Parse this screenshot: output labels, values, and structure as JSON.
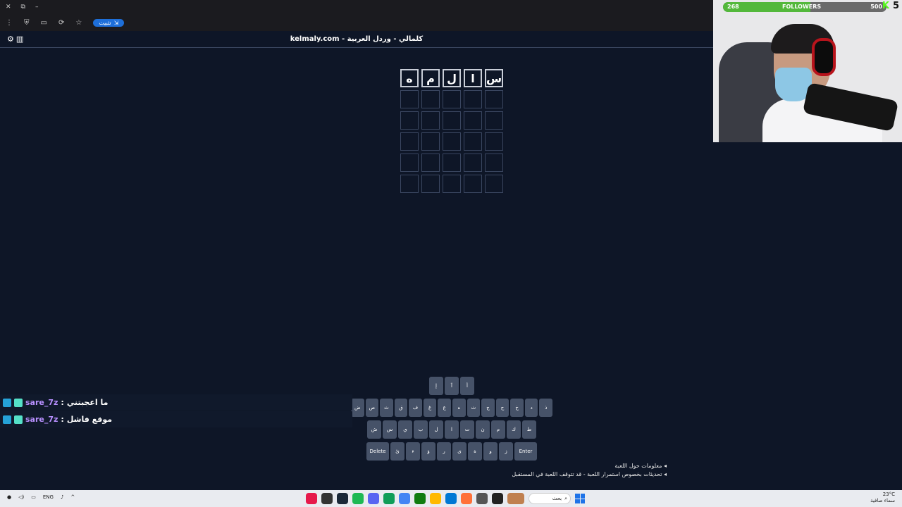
{
  "browser": {
    "pill_label": "تثبيت"
  },
  "site": {
    "title": "kelmaly.com - كلمالي - وردل العربية"
  },
  "board": {
    "rows": [
      [
        "س",
        "ا",
        "ل",
        "م",
        "ه"
      ],
      [
        "",
        "",
        "",
        "",
        ""
      ],
      [
        "",
        "",
        "",
        "",
        ""
      ],
      [
        "",
        "",
        "",
        "",
        ""
      ],
      [
        "",
        "",
        "",
        "",
        ""
      ],
      [
        "",
        "",
        "",
        "",
        ""
      ]
    ]
  },
  "keyboard": {
    "row1": [
      "أ",
      "آ",
      "إ"
    ],
    "row2": [
      "ذ",
      "د",
      "خ",
      "ح",
      "ج",
      "ث",
      "ه",
      "ع",
      "غ",
      "ف",
      "ق",
      "ث",
      "ص",
      "ض"
    ],
    "row3": [
      "ط",
      "ك",
      "م",
      "ن",
      "ت",
      "ا",
      "ل",
      "ب",
      "ي",
      "س",
      "ش"
    ],
    "row4": [
      "Enter",
      "ز",
      "و",
      "ة",
      "ى",
      "ر",
      "ؤ",
      "ء",
      "ئ",
      "Delete"
    ]
  },
  "footer": {
    "about": "معلومات حول اللعبة",
    "updates": "تحديثات بخصوص استمرار اللعبة - قد تتوقف اللعبة في المستقبل"
  },
  "stream": {
    "followers_label": "FOLLOWERS",
    "followers_current": "268",
    "followers_goal": "500",
    "followers_progress": 0.536,
    "brand_letter": "K",
    "brand_number": "5"
  },
  "chat": [
    {
      "user": "sare_7z",
      "text": "ما اعجبتني"
    },
    {
      "user": "sare_7z",
      "text": "موقع فاشل"
    }
  ],
  "taskbar": {
    "lang": "ENG",
    "search_label": "بحث",
    "temperature": "23°C",
    "weather": "سماء صافية"
  },
  "colors": {
    "background": "#0e1627",
    "key": "#465268",
    "followers_bar": "#53b83b",
    "chat_username": "#b890ff"
  }
}
